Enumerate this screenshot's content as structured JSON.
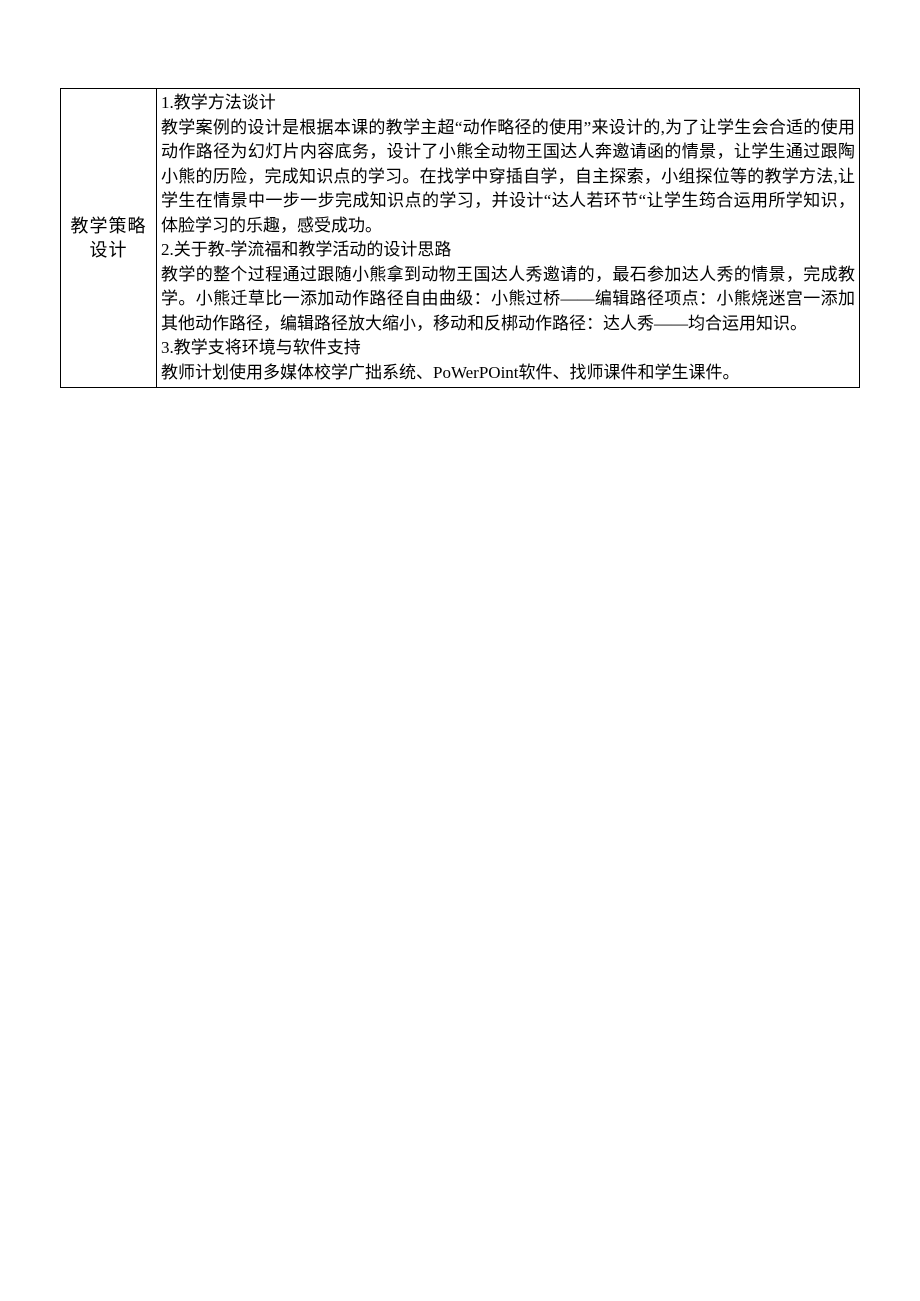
{
  "table": {
    "label": "教学策略设计",
    "content": {
      "h1": "1.教学方法谈计",
      "p1": "教学案例的设计是根据本课的教学主超“动作略径的使用”来设计的,为了让学生会合适的使用动作路径为幻灯片内容底务，设计了小熊全动物王国达人奔邀请函的情景，让学生通过跟陶小熊的历险，完成知识点的学习。在找学中穿插自学，自主探索，小组探位等的教学方法,让学生在情景中一步一步完成知识点的学习，并设计“达人若环节“让学生筠合运用所学知识，体脸学习的乐趣，感受成功。",
      "h2": "2.关于教-学流福和教学活动的设计思路",
      "p2": "教学的整个过程通过跟随小熊拿到动物王国达人秀邀请的，最石参加达人秀的情景，完成教学。小熊迁草比一添加动作路径自由曲级：小熊过桥——编辑路径项点：小熊烧迷宫一添加其他动作路径，编辑路径放大缩小，移动和反梆动作路径：达人秀——均合运用知识。",
      "h3": "3.教学支将环境与软件支持",
      "p3": "教师计划使用多媒体校学广拙系统、PoWerPOint软件、找师课件和学生课件。"
    }
  }
}
